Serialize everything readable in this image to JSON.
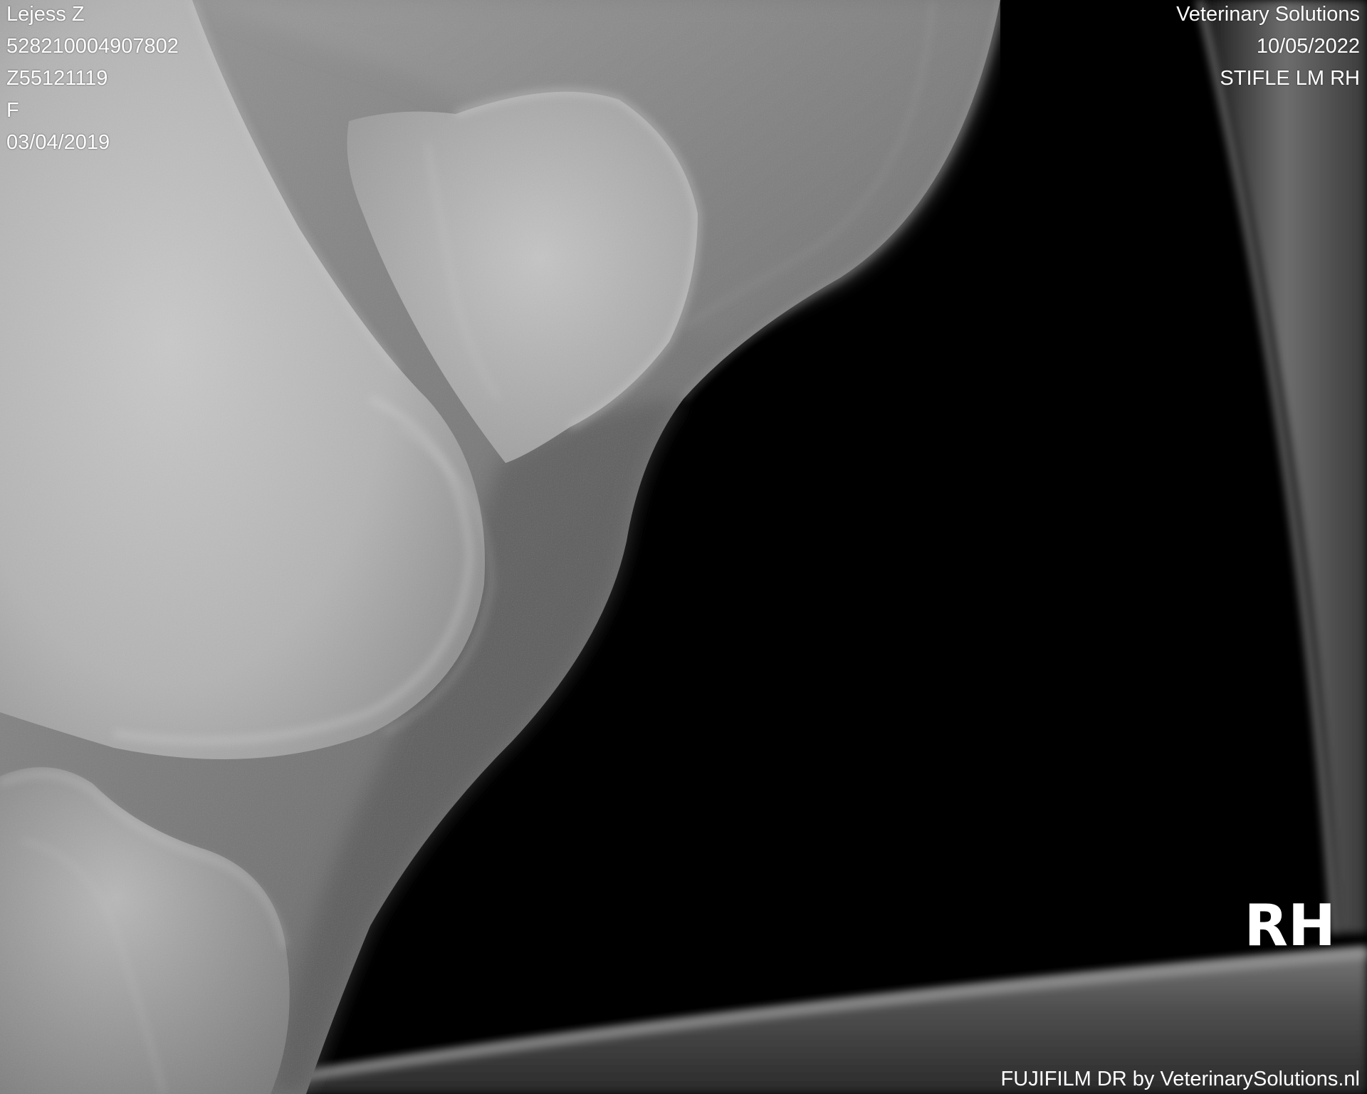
{
  "patient_info": {
    "name": "Lejess Z",
    "chip_number": "528210004907802",
    "patient_id": "Z55121119",
    "sex": "F",
    "birth_date": "03/04/2019"
  },
  "study_info": {
    "institution": "Veterinary Solutions",
    "study_date": "10/05/2022",
    "view": "STIFLE LM RH"
  },
  "side_marker": "RH",
  "footer": "FUJIFILM DR by VeterinarySolutions.nl",
  "colors": {
    "overlay_text": "#ffffff",
    "background": "#000000"
  }
}
